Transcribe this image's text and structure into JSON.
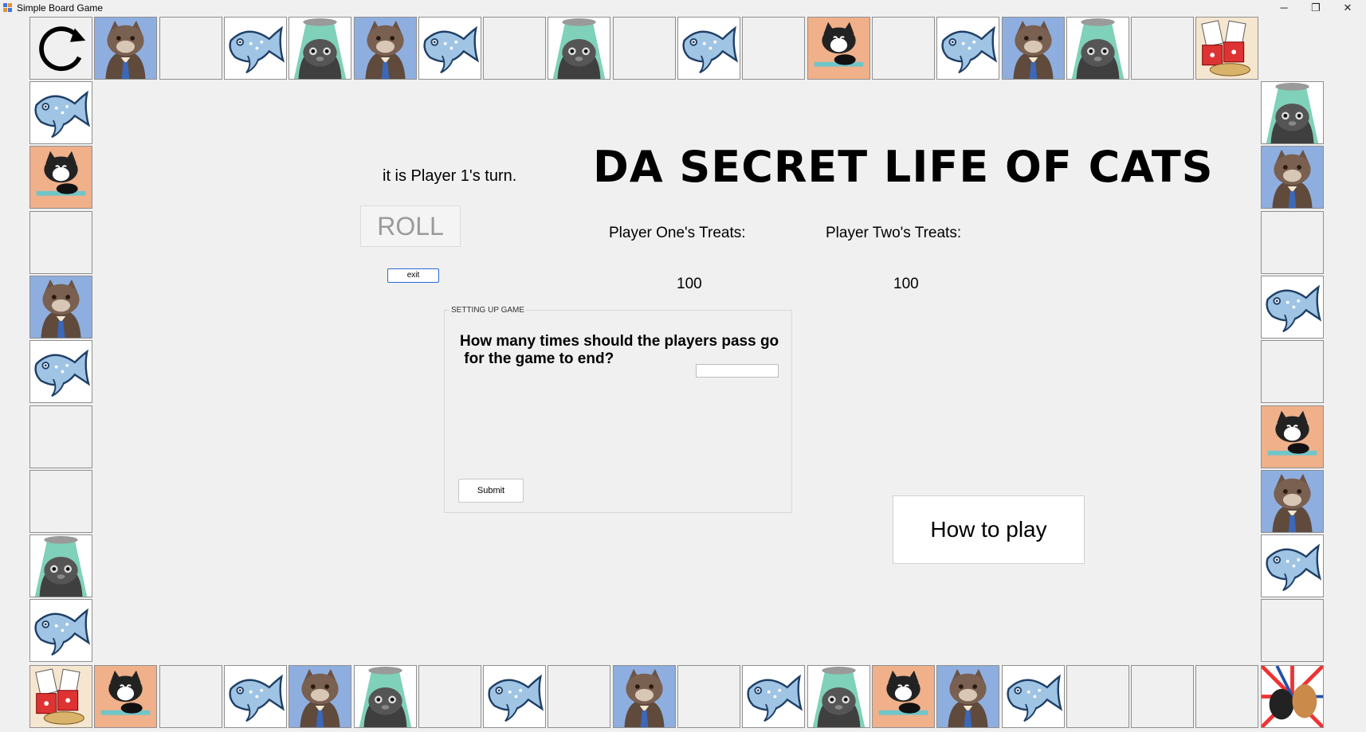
{
  "window": {
    "title": "Simple Board Game",
    "minimize_glyph": "─",
    "restore_glyph": "❐",
    "close_glyph": "✕"
  },
  "game": {
    "title": "DA SECRET LIFE OF CATS",
    "turn_text": "it is Player 1's turn.",
    "roll_label": "ROLL",
    "exit_label": "exit",
    "player_one_label": "Player One's Treats:",
    "player_two_label": "Player Two's Treats:",
    "player_one_treats": "100",
    "player_two_treats": "100",
    "how_to_play_label": "How to play"
  },
  "setup": {
    "group_title": "SETTING UP GAME",
    "question_line1": "How many times should the players pass go",
    "question_line2": " for the game to end?",
    "answer_value": "",
    "submit_label": "Submit"
  },
  "board": {
    "top": [
      "go",
      "cat-tie",
      "empty",
      "fish",
      "ufo-cat",
      "cat-tie",
      "fish",
      "empty",
      "ufo-cat",
      "empty",
      "fish",
      "empty",
      "tuxedo-cat",
      "empty",
      "fish",
      "cat-tie",
      "ufo-cat",
      "empty",
      "casino"
    ],
    "left": [
      "fish",
      "tuxedo-cat",
      "empty",
      "cat-tie",
      "fish",
      "empty",
      "empty",
      "ufo-cat",
      "fish"
    ],
    "right": [
      "ufo-cat",
      "cat-tie",
      "empty",
      "fish",
      "empty",
      "tuxedo-cat",
      "cat-tie",
      "fish",
      "empty"
    ],
    "bottom": [
      "casino",
      "tuxedo-cat",
      "empty",
      "fish",
      "cat-tie",
      "ufo-cat",
      "empty",
      "fish",
      "empty",
      "cat-tie",
      "empty",
      "fish",
      "ufo-cat",
      "tuxedo-cat",
      "cat-tie",
      "fish",
      "empty",
      "empty",
      "empty",
      "fight"
    ]
  }
}
